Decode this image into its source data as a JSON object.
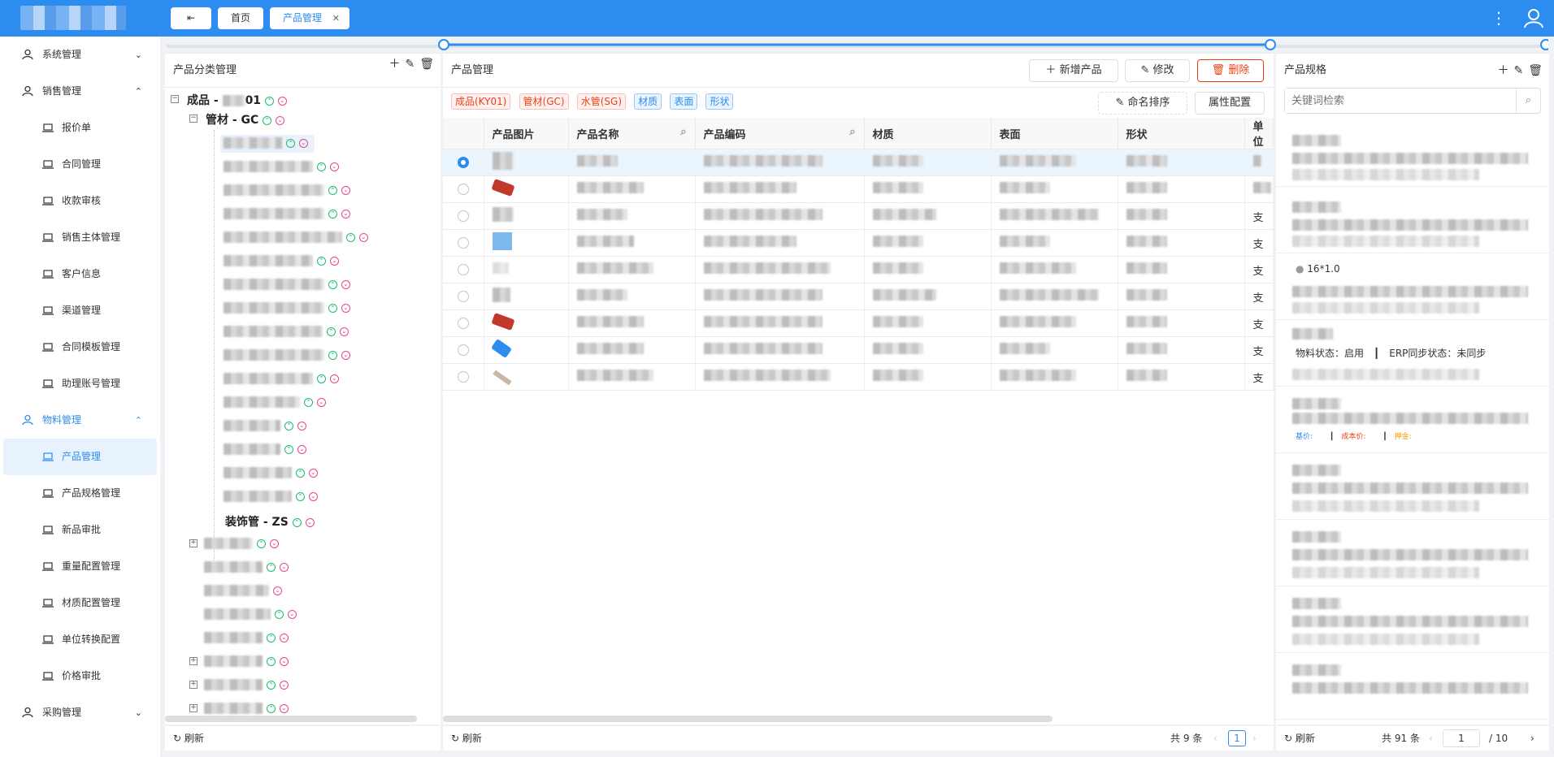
{
  "topbar": {
    "toggle_label": "⇤",
    "tabs": [
      {
        "label": "首页"
      },
      {
        "label": "产品管理"
      }
    ],
    "close_glyph": "✕"
  },
  "sidebar": {
    "items": [
      {
        "label": "系统管理"
      },
      {
        "label": "销售管理"
      },
      {
        "label": "报价单"
      },
      {
        "label": "合同管理"
      },
      {
        "label": "收款审核"
      },
      {
        "label": "销售主体管理"
      },
      {
        "label": "客户信息"
      },
      {
        "label": "渠道管理"
      },
      {
        "label": "合同模板管理"
      },
      {
        "label": "助理账号管理"
      },
      {
        "label": "物料管理"
      },
      {
        "label": "产品管理"
      },
      {
        "label": "产品规格管理"
      },
      {
        "label": "新品审批"
      },
      {
        "label": "重量配置管理"
      },
      {
        "label": "材质配置管理"
      },
      {
        "label": "单位转换配置"
      },
      {
        "label": "价格审批"
      },
      {
        "label": "采购管理"
      }
    ]
  },
  "category_panel": {
    "title": "产品分类管理",
    "root_prefix": "成品 - ",
    "root_suffix": "01",
    "child_label": "管材 - GC",
    "deco_label": "装饰管 - ZS",
    "refresh": "刷新"
  },
  "product_panel": {
    "title": "产品管理",
    "add_label": "新增产品",
    "edit_label": "修改",
    "delete_label": "删除",
    "tags_red": [
      "成品(KY01)",
      "管材(GC)",
      "水管(SG)"
    ],
    "tags_blue": [
      "材质",
      "表面",
      "形状"
    ],
    "sort_label": "命名排序",
    "attr_label": "属性配置",
    "columns": [
      "产品图片",
      "产品名称",
      "产品编码",
      "材质",
      "表面",
      "形状",
      "单位"
    ],
    "unit_values": [
      "支",
      "支",
      "支",
      "支",
      "支",
      "支",
      "支"
    ],
    "refresh": "刷新",
    "total": "共 9 条",
    "page": "1"
  },
  "spec_panel": {
    "title": "产品规格",
    "search_placeholder": "关键词检索",
    "spec_name": "16*1.0",
    "status_text": "物料状态：启用",
    "erp_text": "ERP同步状态：未同步",
    "base_price": "基价: ",
    "cost_price": "成本价: ",
    "deposit": "押金: ",
    "refresh": "刷新",
    "total": "共 91 条",
    "page_value": "1",
    "page_total": "/  10"
  },
  "colors": {
    "primary": "#2d8cf0",
    "danger": "#ed4014",
    "up": "#19be6b",
    "down": "#e84393"
  }
}
